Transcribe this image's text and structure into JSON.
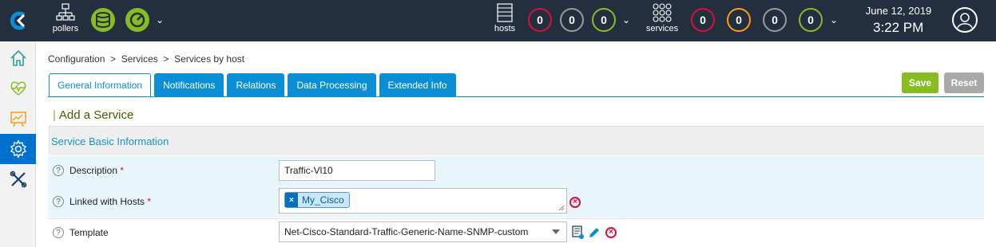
{
  "topbar": {
    "pollers_label": "pollers",
    "hosts_label": "hosts",
    "services_label": "services",
    "host_counts": [
      "0",
      "0",
      "0"
    ],
    "service_counts": [
      "0",
      "0",
      "0",
      "0"
    ],
    "date": "June 12, 2019",
    "time": "3:22 PM",
    "colors": {
      "critical": "#e00b3d",
      "unreachable": "#9a9a9a",
      "ok": "#87bd23",
      "warning": "#ff9a13"
    }
  },
  "sidebar": {
    "items": [
      {
        "icon": "home-icon"
      },
      {
        "icon": "monitoring-icon"
      },
      {
        "icon": "reporting-icon"
      },
      {
        "icon": "configuration-gear-icon",
        "active": true
      },
      {
        "icon": "administration-tools-icon"
      }
    ]
  },
  "breadcrumb": "Configuration  >  Services  >  Services by host",
  "tabs": [
    {
      "label": "General Information",
      "active": true
    },
    {
      "label": "Notifications"
    },
    {
      "label": "Relations"
    },
    {
      "label": "Data Processing"
    },
    {
      "label": "Extended Info"
    }
  ],
  "buttons": {
    "save": "Save",
    "reset": "Reset"
  },
  "form": {
    "title": "Add a Service",
    "section": "Service Basic Information",
    "fields": {
      "description": {
        "label": "Description",
        "required": "*",
        "value": "Traffic-Vl10"
      },
      "linked_hosts": {
        "label": "Linked with Hosts",
        "required": "*",
        "tags": [
          "My_Cisco"
        ]
      },
      "template": {
        "label": "Template",
        "value": "Net-Cisco-Standard-Traffic-Generic-Name-SNMP-custom"
      }
    }
  }
}
